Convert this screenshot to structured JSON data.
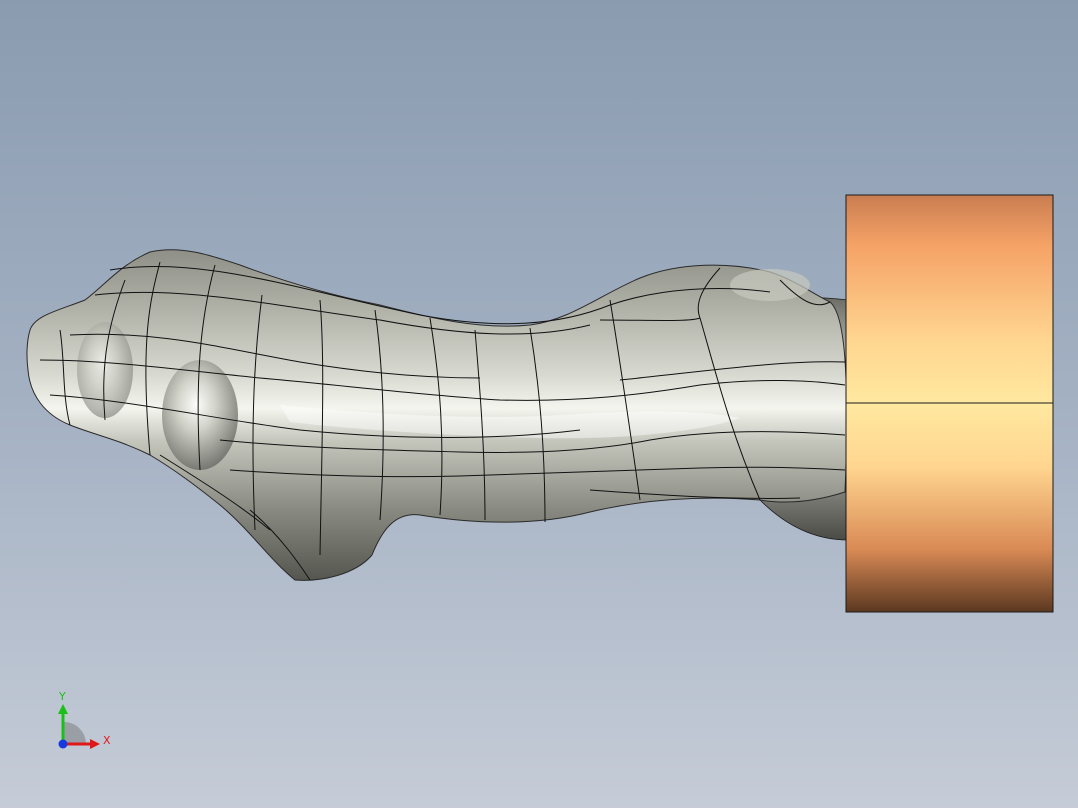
{
  "viewport": {
    "background_top": "#8a9bb0",
    "background_bottom": "#c5ccd7"
  },
  "model": {
    "body_color": "#b9bab0",
    "body_highlight": "#f2f3ec",
    "body_shadow": "#5f605a",
    "block_color_mid": "#ffe79a",
    "block_color_top": "#c97d50",
    "block_color_bottom": "#5b3820",
    "edge_color": "#1a1a1a"
  },
  "triad": {
    "x_label": "X",
    "y_label": "Y",
    "x_color": "#e01818",
    "y_color": "#18c018",
    "z_color": "#1838e0"
  }
}
